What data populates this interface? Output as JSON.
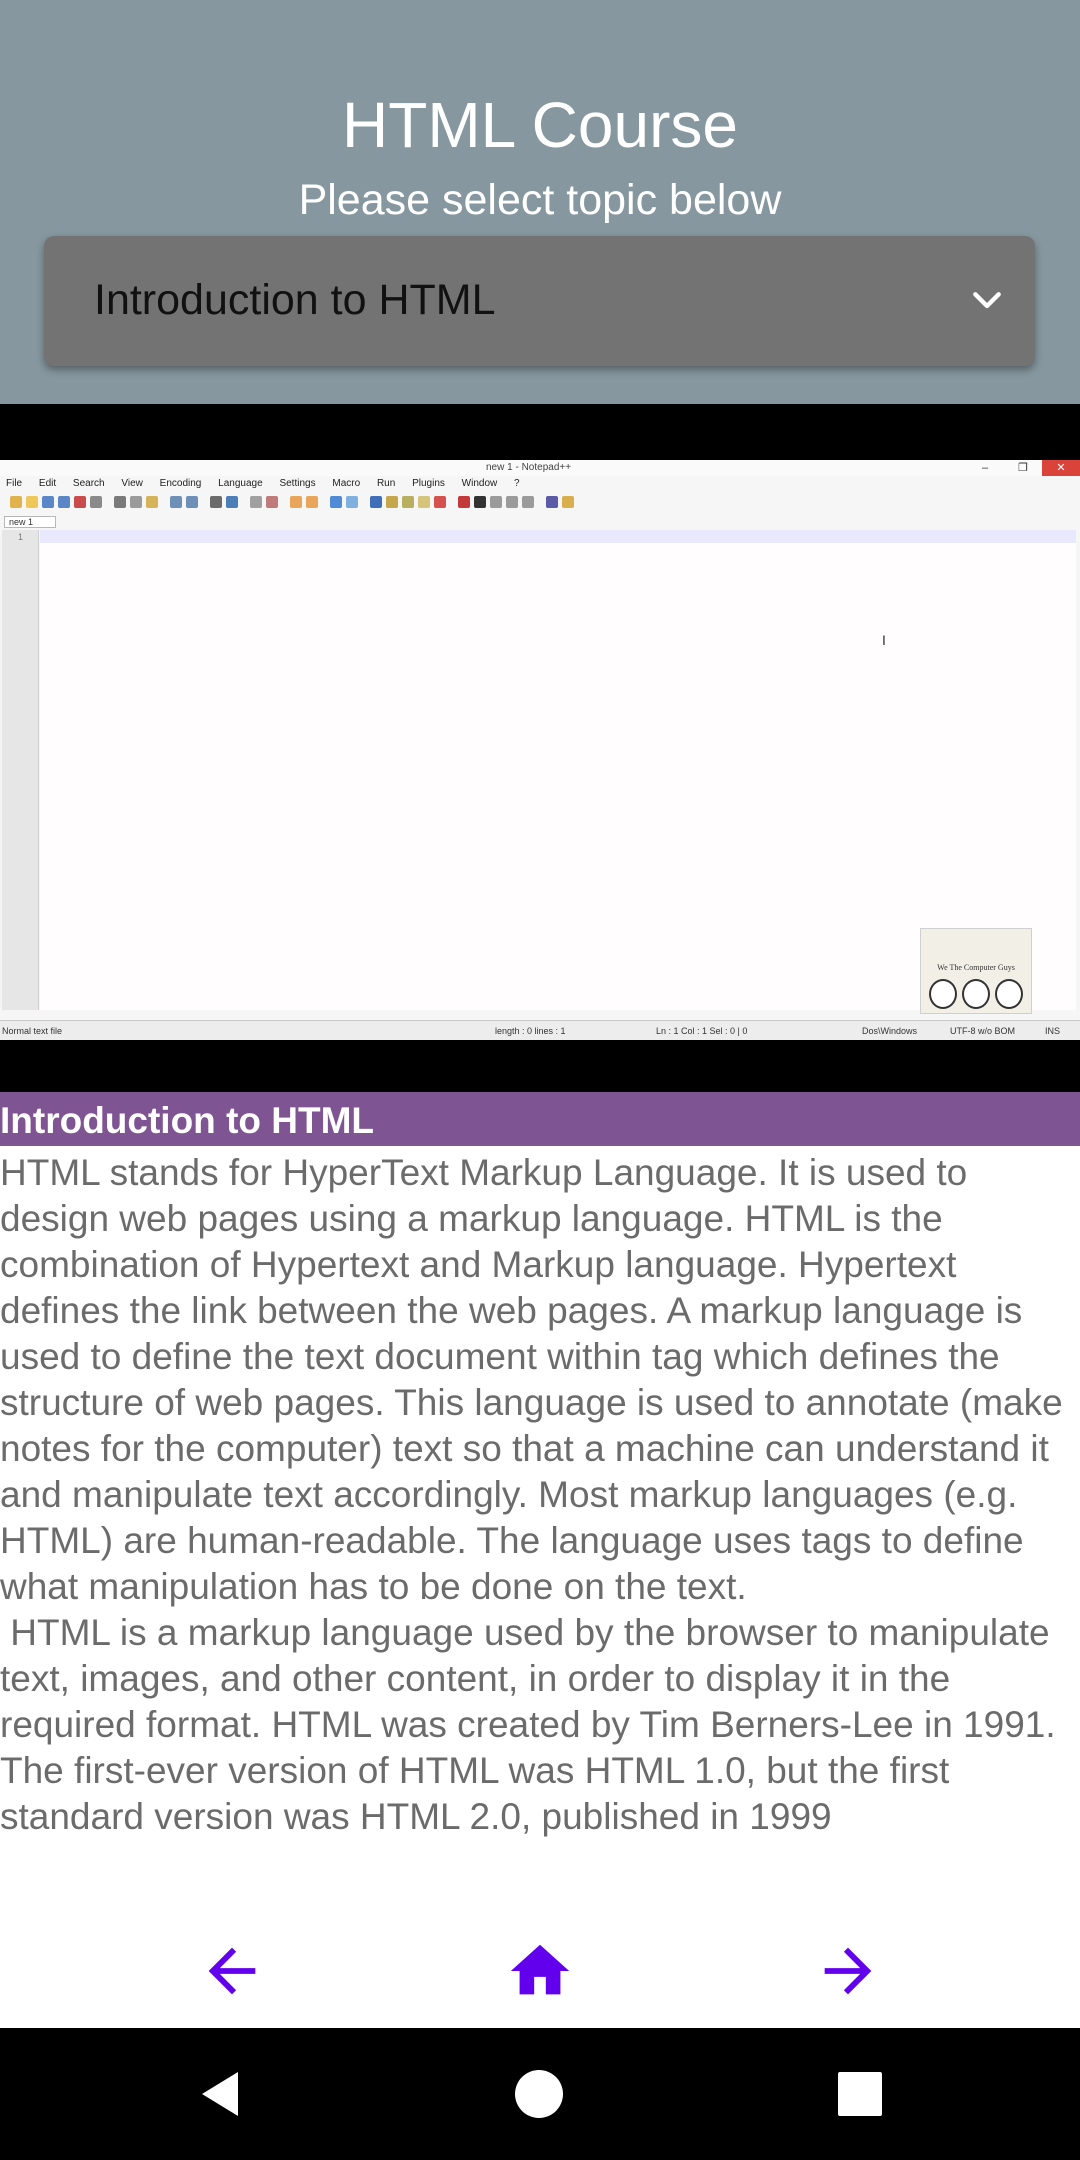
{
  "header": {
    "title": "HTML Course",
    "subtitle": "Please select topic below",
    "topic_select": {
      "selected": "Introduction to HTML"
    }
  },
  "video": {
    "window_title": "new 1 - Notepad++",
    "menu": [
      "File",
      "Edit",
      "Search",
      "View",
      "Encoding",
      "Language",
      "Settings",
      "Macro",
      "Run",
      "Plugins",
      "Window",
      "?"
    ],
    "tab_label": "new 1",
    "line_number": "1",
    "logo_text": "We The Computer Guys",
    "status": {
      "file_type": "Normal text file",
      "length": "length : 0    lines : 1",
      "position": "Ln : 1    Col : 1    Sel : 0 | 0",
      "eol": "Dos\\Windows",
      "encoding": "UTF-8 w/o BOM",
      "mode": "INS"
    }
  },
  "content": {
    "section_title": "Introduction to HTML",
    "body": "HTML stands for HyperText Markup Language. It is used to design web pages using a markup language. HTML is the combination of Hypertext and Markup language. Hypertext defines the link between the web pages. A markup language is used to define the text document within tag which defines the structure of web pages. This language is used to annotate (make notes for the computer) text so that a machine can understand it and manipulate text accordingly. Most markup languages (e.g. HTML) are human-readable. The language uses tags to define what manipulation has to be done on the text.\n HTML is a markup language used by the browser to manipulate text, images, and other content, in order to display it in the required format. HTML was created by Tim Berners-Lee in 1991. The first-ever version of HTML was HTML 1.0, but the first standard version was HTML 2.0, published in 1999"
  },
  "bottom_nav": {
    "icons": [
      "arrow-back-icon",
      "home-icon",
      "arrow-forward-icon"
    ],
    "accent_color": "#6200ee"
  },
  "system_nav": {
    "icons": [
      "back-icon",
      "home-icon",
      "recents-icon"
    ]
  },
  "colors": {
    "header_bg": "#86979f",
    "select_bg": "#737373",
    "section_bar": "#7e5592",
    "body_text": "#6b6b6b"
  }
}
